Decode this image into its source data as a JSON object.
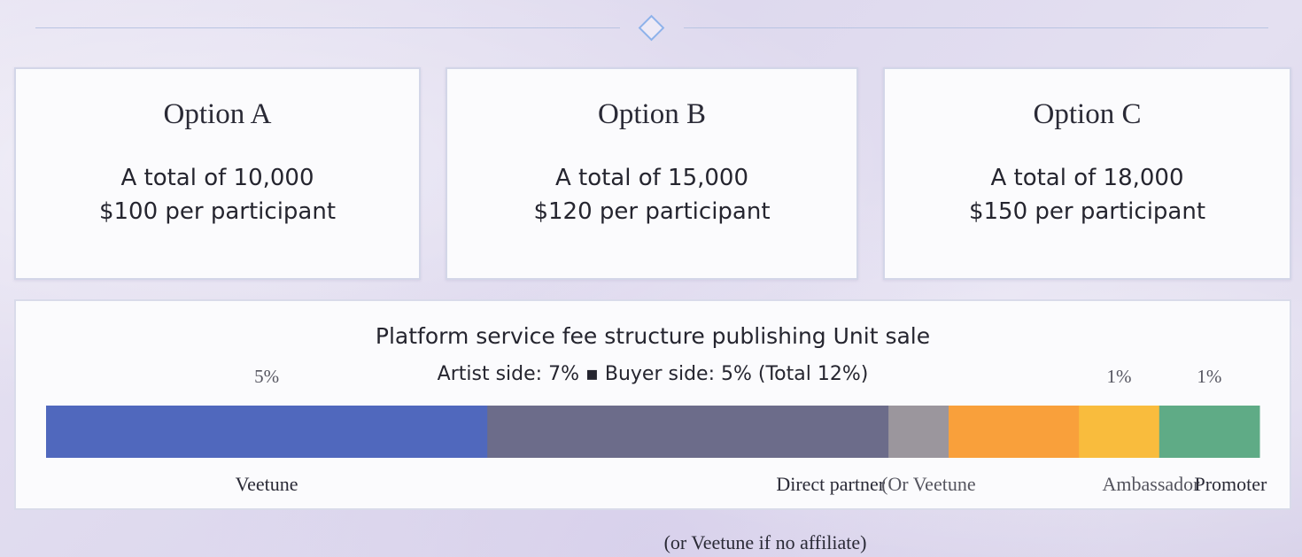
{
  "options": [
    {
      "title": "Option A",
      "total_text": "A total of 10,000",
      "price_text": "$100 per participant"
    },
    {
      "title": "Option B",
      "total_text": "A total of 15,000",
      "price_text": "$120 per participant"
    },
    {
      "title": "Option C",
      "total_text": "A total of 18,000",
      "price_text": "$150 per participant"
    }
  ],
  "fee_panel": {
    "title": "Platform service fee structure publishing Unit sale",
    "subtitle": "Artist side: 7% ▪ Buyer side: 5% (Total 12%)",
    "footnote": "(or Veetune if no affiliate)"
  },
  "chart_data": {
    "type": "bar",
    "orientation": "horizontal-stacked",
    "total": 12,
    "segments": [
      {
        "category": "Veetune",
        "value": 4.4,
        "value_label": "5%",
        "color": "#5068bd"
      },
      {
        "category": "Direct partner",
        "value": 4.0,
        "value_label": "",
        "color": "#6c6c8a"
      },
      {
        "category": "(Or Veetune",
        "value": 0.6,
        "value_label": "",
        "color": "#9b969d"
      },
      {
        "category": "",
        "value": 1.3,
        "value_label": "",
        "color": "#f9a03b"
      },
      {
        "category": "Ambassador",
        "value": 0.8,
        "value_label": "1%",
        "color": "#f9bc3d"
      },
      {
        "category": "Promoter",
        "value": 1.0,
        "value_label": "1%",
        "color": "#5fab86"
      }
    ]
  },
  "colors": {
    "divider": "#b9c4e2",
    "diamond": "#8eb2ea",
    "card_border": "#d3d6e8"
  }
}
